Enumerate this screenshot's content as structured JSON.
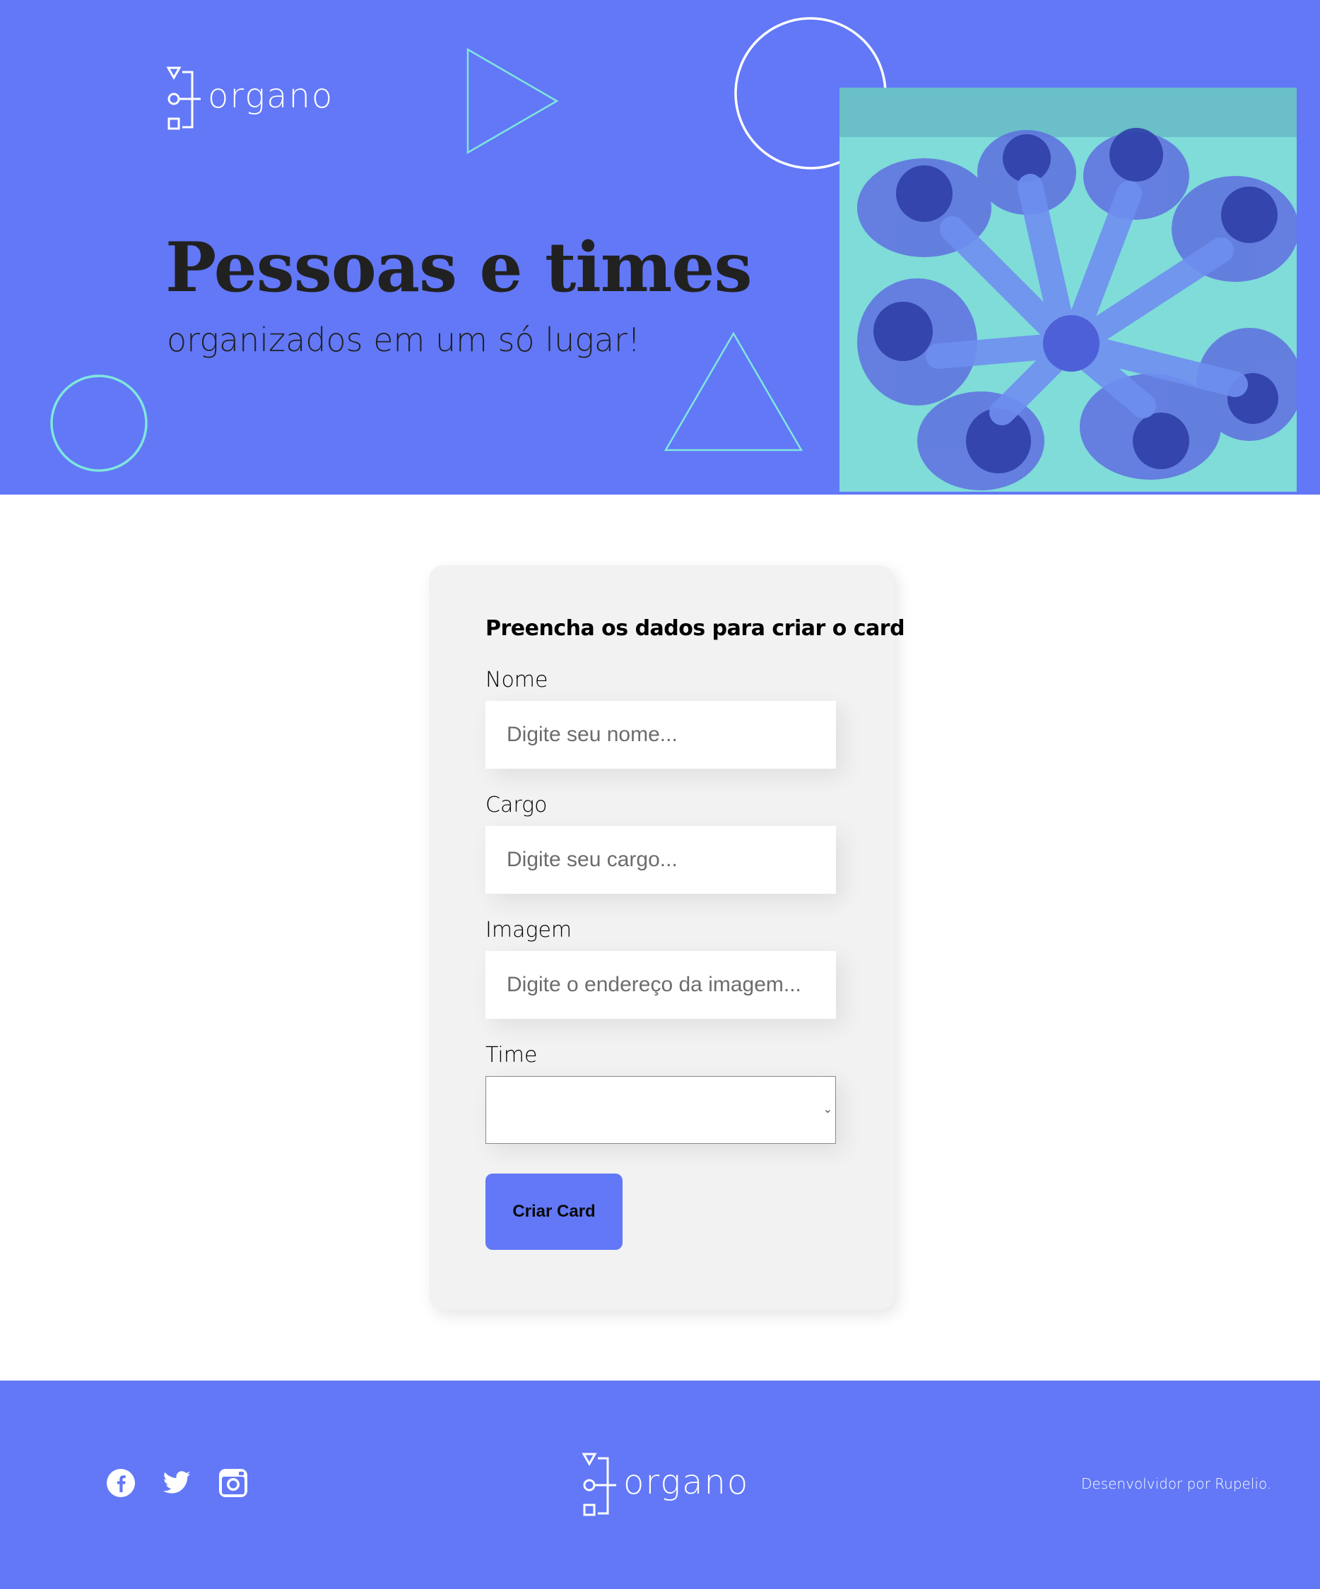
{
  "brand": {
    "name": "organo"
  },
  "hero": {
    "title": "Pessoas e times",
    "subtitle": "organizados em um só lugar!",
    "photo_icon": "team-hands-photo"
  },
  "form": {
    "title": "Preencha os dados para criar o card",
    "fields": [
      {
        "label": "Nome",
        "placeholder": "Digite seu nome..."
      },
      {
        "label": "Cargo",
        "placeholder": "Digite seu cargo..."
      },
      {
        "label": "Imagem",
        "placeholder": "Digite o endereço da imagem..."
      }
    ],
    "team": {
      "label": "Time",
      "value": ""
    },
    "submit_label": "Criar Card"
  },
  "footer": {
    "social": [
      "facebook-icon",
      "twitter-icon",
      "instagram-icon"
    ],
    "credit": "Desenvolvidor por Rupelio."
  },
  "colors": {
    "brand_blue": "#6278f7",
    "accent_teal": "#7fdcd8",
    "card_bg": "#f2f2f2",
    "text_dark": "#212121"
  }
}
